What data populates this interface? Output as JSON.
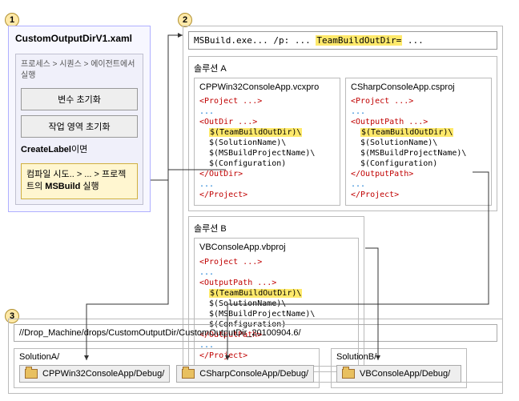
{
  "badges": {
    "b1": "1",
    "b2": "2",
    "b3": "3"
  },
  "panel1": {
    "title": "CustomOutputDirV1.xaml",
    "subtext": "프로세스 > 시퀀스 > 에이전트에서 실행",
    "btn1": "변수 초기화",
    "btn2": "작업 영역 초기화",
    "labelline_pre": "CreateLabel",
    "labelline_post": "이면",
    "hl_pre": "컴파일 시도.. > ... > 프로젝트의 ",
    "hl_bold": "MSBuild",
    "hl_post": " 실행"
  },
  "panel2": {
    "cmd_pre": "MSBuild.exe... /p: ... ",
    "cmd_var": "TeamBuildOutDir=",
    "cmd_post": " ...",
    "solA": "솔루션 A",
    "solB": "솔루션 B",
    "projA1_name": "CPPWin32ConsoleApp.vcxpro",
    "projA1_tagOpen": "<Project ...>",
    "projA1_outOpen": "<OutDir ...>",
    "projA1_outClose": "</OutDir>",
    "projA2_name": "CSharpConsoleApp.csproj",
    "projA2_tagOpen": "<Project ...>",
    "projA2_outOpen": "<OutputPath ...>",
    "projA2_outClose": "</OutputPath>",
    "projB_name": "VBConsoleApp.vbproj",
    "projB_tagOpen": "<Project ...>",
    "projB_outOpen": "<OutputPath ...>",
    "projB_outClose": "</OutputPath>",
    "line_var": "$(TeamBuildOutDir)\\",
    "line_sn": "$(SolutionName)\\",
    "line_pn": "$(MSBuildProjectName)\\",
    "line_cfg": "$(Configuration)",
    "ellipsis": "...",
    "projClose": "</Project>"
  },
  "panel3": {
    "dropline": "//Drop_Machine/drops/CustomOutputDir/CustomOutputDir_20100904.6/",
    "solA": "SolutionA/",
    "solB": "SolutionB/",
    "folderA1": "CPPWin32ConsoleApp/Debug/",
    "folderA2": "CSharpConsoleApp/Debug/",
    "folderB": "VBConsoleApp/Debug/"
  }
}
